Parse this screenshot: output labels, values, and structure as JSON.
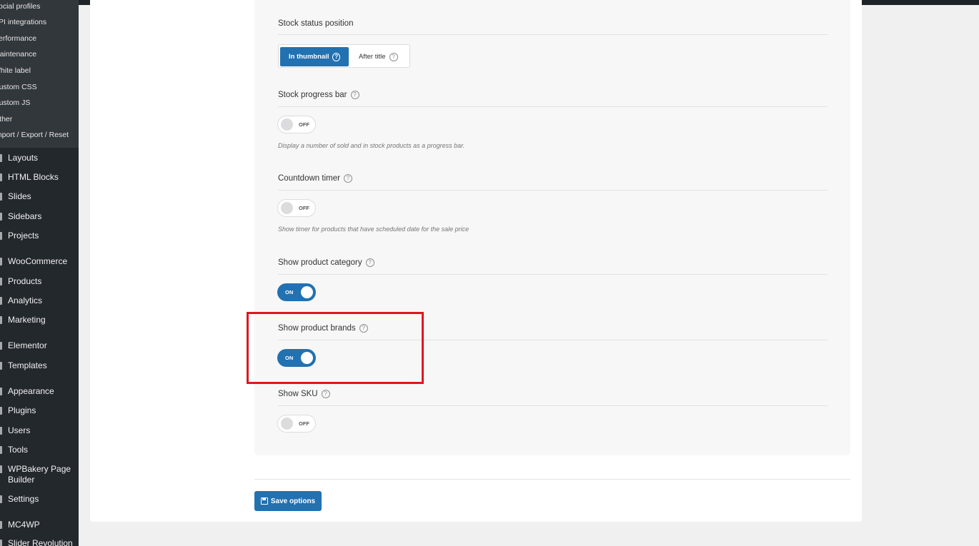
{
  "sidebar": {
    "submenu": [
      "Social profiles",
      "API integrations",
      "Performance",
      "Maintenance",
      "White label",
      "Custom CSS",
      "Custom JS",
      "Other",
      "Import / Export / Reset"
    ],
    "menu": [
      {
        "label": "Layouts",
        "icon": "layouts-icon"
      },
      {
        "label": "HTML Blocks",
        "icon": "html-blocks-icon"
      },
      {
        "label": "Slides",
        "icon": "slides-icon"
      },
      {
        "label": "Sidebars",
        "icon": "sidebars-icon"
      },
      {
        "label": "Projects",
        "icon": "projects-icon"
      },
      {
        "label": "WooCommerce",
        "icon": "woocommerce-icon"
      },
      {
        "label": "Products",
        "icon": "products-icon"
      },
      {
        "label": "Analytics",
        "icon": "analytics-icon"
      },
      {
        "label": "Marketing",
        "icon": "marketing-icon"
      },
      {
        "label": "Elementor",
        "icon": "elementor-icon"
      },
      {
        "label": "Templates",
        "icon": "templates-icon"
      },
      {
        "label": "Appearance",
        "icon": "appearance-icon"
      },
      {
        "label": "Plugins",
        "icon": "plugins-icon"
      },
      {
        "label": "Users",
        "icon": "users-icon"
      },
      {
        "label": "Tools",
        "icon": "tools-icon"
      },
      {
        "label": "WPBakery Page",
        "label2": "Builder",
        "icon": "wpbakery-icon"
      },
      {
        "label": "Settings",
        "icon": "settings-icon"
      },
      {
        "label": "MC4WP",
        "icon": "mc4wp-icon"
      },
      {
        "label": "Slider Revolution",
        "icon": "slider-revolution-icon"
      }
    ]
  },
  "options": {
    "stock_status_position": {
      "title": "Stock status position",
      "choices": [
        "In thumbnail",
        "After title"
      ],
      "selected": "In thumbnail"
    },
    "stock_progress_bar": {
      "title": "Stock progress bar",
      "state": "OFF",
      "description": "Display a number of sold and in stock products as a progress bar."
    },
    "countdown_timer": {
      "title": "Countdown timer",
      "state": "OFF",
      "description": "Show timer for products that have scheduled date for the sale price"
    },
    "show_product_category": {
      "title": "Show product category",
      "state": "ON"
    },
    "show_product_brands": {
      "title": "Show product brands",
      "state": "ON"
    },
    "show_sku": {
      "title": "Show SKU",
      "state": "OFF"
    }
  },
  "help_glyph": "?",
  "save_button": {
    "label": "Save options",
    "icon": "floppy-disk-icon"
  },
  "colors": {
    "accent": "#2271b1",
    "highlight": "#e0161e",
    "sidebar_bg": "#23282d"
  }
}
